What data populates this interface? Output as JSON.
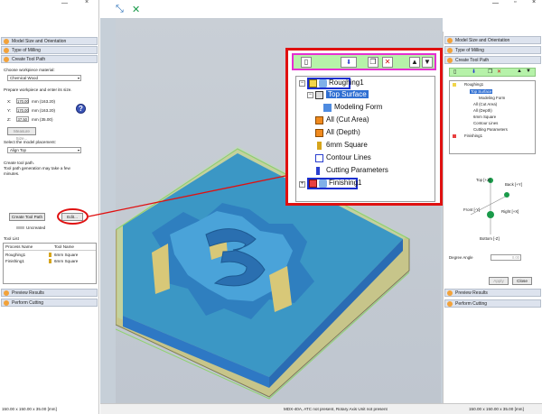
{
  "left_panel": {
    "window_buttons": {
      "minimize": "—",
      "close": "×"
    },
    "sections": {
      "model_size": "Model Size and Orientation",
      "type_of_milling": "Type of Milling",
      "create_tool_path": "Create Tool Path",
      "preview_results": "Preview Results",
      "perform_cutting": "Perform Cutting"
    },
    "material_label": "Choose workpiece material:",
    "material_value": "Chemical Wood",
    "size_label": "Prepare workpiece and enter its size.",
    "x_label": "X:",
    "x_value": "170.00",
    "x_unit": "mm  (163.20)",
    "y_label": "Y:",
    "y_value": "170.00",
    "y_unit": "mm  (163.20)",
    "z_label": "Z:",
    "z_value": "37.50",
    "z_unit": "mm  (35.00)",
    "measure_button": "Measure Size...",
    "placement_label": "Select the model placement:",
    "placement_value": "Align Top",
    "create_text_1": "Create tool path.",
    "create_text_2": "Tool path generation may take a few",
    "create_text_3": "minutes.",
    "create_button": "Create Tool Path",
    "edit_button": "Edit...",
    "uncreated_label": "Uncreated",
    "tool_list_label": "Tool List",
    "table_headers": [
      "Process Name",
      "Tool Name"
    ],
    "table_rows": [
      {
        "process": "Roughing1",
        "tool": "6mm Square"
      },
      {
        "process": "Finishing1",
        "tool": "6mm Square"
      }
    ],
    "size_readout": "150.00 x 150.00 x 35.00 [mm]"
  },
  "status_bar": {
    "text": "MDX-40A, ATC not present, Rotary Axis Unit not present",
    "size": "150.00 x 150.00 x 35.00 [mm]"
  },
  "popup": {
    "toolbar_icons": [
      "new-icon",
      "tool-icon",
      "copy-icon",
      "delete-icon",
      "up-icon",
      "down-icon"
    ],
    "delete_glyph": "✕",
    "up_glyph": "▲",
    "down_glyph": "▼",
    "expand_minus": "−",
    "expand_plus": "+",
    "tree": {
      "roughing": "Roughing1",
      "top_surface": "Top Surface",
      "modeling_form": "Modeling Form",
      "cut_area": "All (Cut Area)",
      "depth": "All (Depth)",
      "tool": "6mm Square",
      "contour": "Contour Lines",
      "cutting_params": "Cutting Parameters",
      "finishing": "Finishing1"
    }
  },
  "right_panel": {
    "sections": {
      "model_size": "Model Size and Orientation",
      "type_of_milling": "Type of Milling",
      "create_tool_path": "Create Tool Path",
      "preview_results": "Preview Results",
      "perform_cutting": "Perform Cutting"
    },
    "tree": {
      "roughing": "Roughing1",
      "top_surface": "Top Surface",
      "modeling_form": "Modeling Form",
      "cut_area": "All (Cut Area)",
      "depth": "All (Depth)",
      "tool": "6mm Square",
      "contour": "Contour Lines",
      "cutting_params": "Cutting Parameters",
      "finishing": "Finishing1"
    },
    "directions": {
      "top": "Top [+Z]",
      "back": "Back [+Y]",
      "front": "Front [-Y]",
      "right": "Right [+X]",
      "bottom": "Bottom [-Z]"
    },
    "degree_angle": "Degree Angle",
    "degree_value": "0.00",
    "apply_button": "Apply",
    "close_button": "Close"
  },
  "colors": {
    "callout_red": "#e01010",
    "toolbar_green": "#b6f2a9",
    "toolbar_magenta": "#e62fd1",
    "highlight_blue": "#1a2fcf",
    "section_orange": "#f2a23a"
  }
}
